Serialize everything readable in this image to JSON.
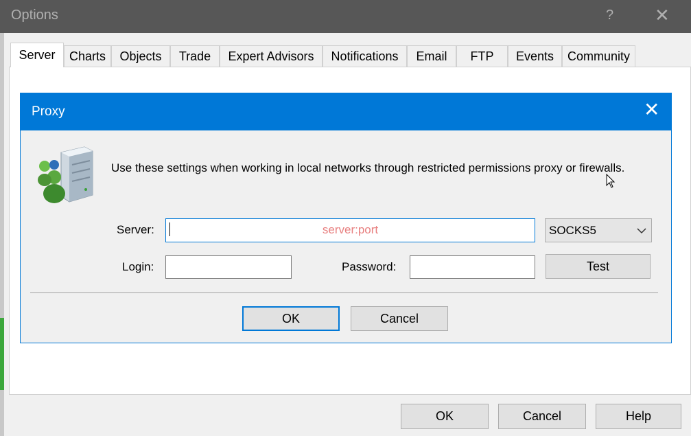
{
  "window": {
    "title": "Options",
    "help_glyph": "?",
    "close_glyph": "✕"
  },
  "tabs": [
    {
      "label": "Server",
      "active": true
    },
    {
      "label": "Charts"
    },
    {
      "label": "Objects"
    },
    {
      "label": "Trade"
    },
    {
      "label": "Expert Advisors"
    },
    {
      "label": "Notifications"
    },
    {
      "label": "Email"
    },
    {
      "label": "FTP"
    },
    {
      "label": "Events"
    },
    {
      "label": "Community"
    }
  ],
  "proxy_dialog": {
    "title": "Proxy",
    "close_glyph": "✕",
    "icon": "network-users-server-icon",
    "description": "Use these settings when working in local networks through restricted permissions proxy or firewalls.",
    "server_label": "Server:",
    "server_value": "",
    "server_placeholder": "server:port",
    "proxy_type": "SOCKS5",
    "login_label": "Login:",
    "login_value": "",
    "password_label": "Password:",
    "password_value": "",
    "test_button": "Test",
    "ok_button": "OK",
    "cancel_button": "Cancel"
  },
  "footer": {
    "ok": "OK",
    "cancel": "Cancel",
    "help": "Help"
  },
  "colors": {
    "accent": "#0078d7",
    "titlebar": "#575757",
    "placeholder": "#e88080"
  }
}
